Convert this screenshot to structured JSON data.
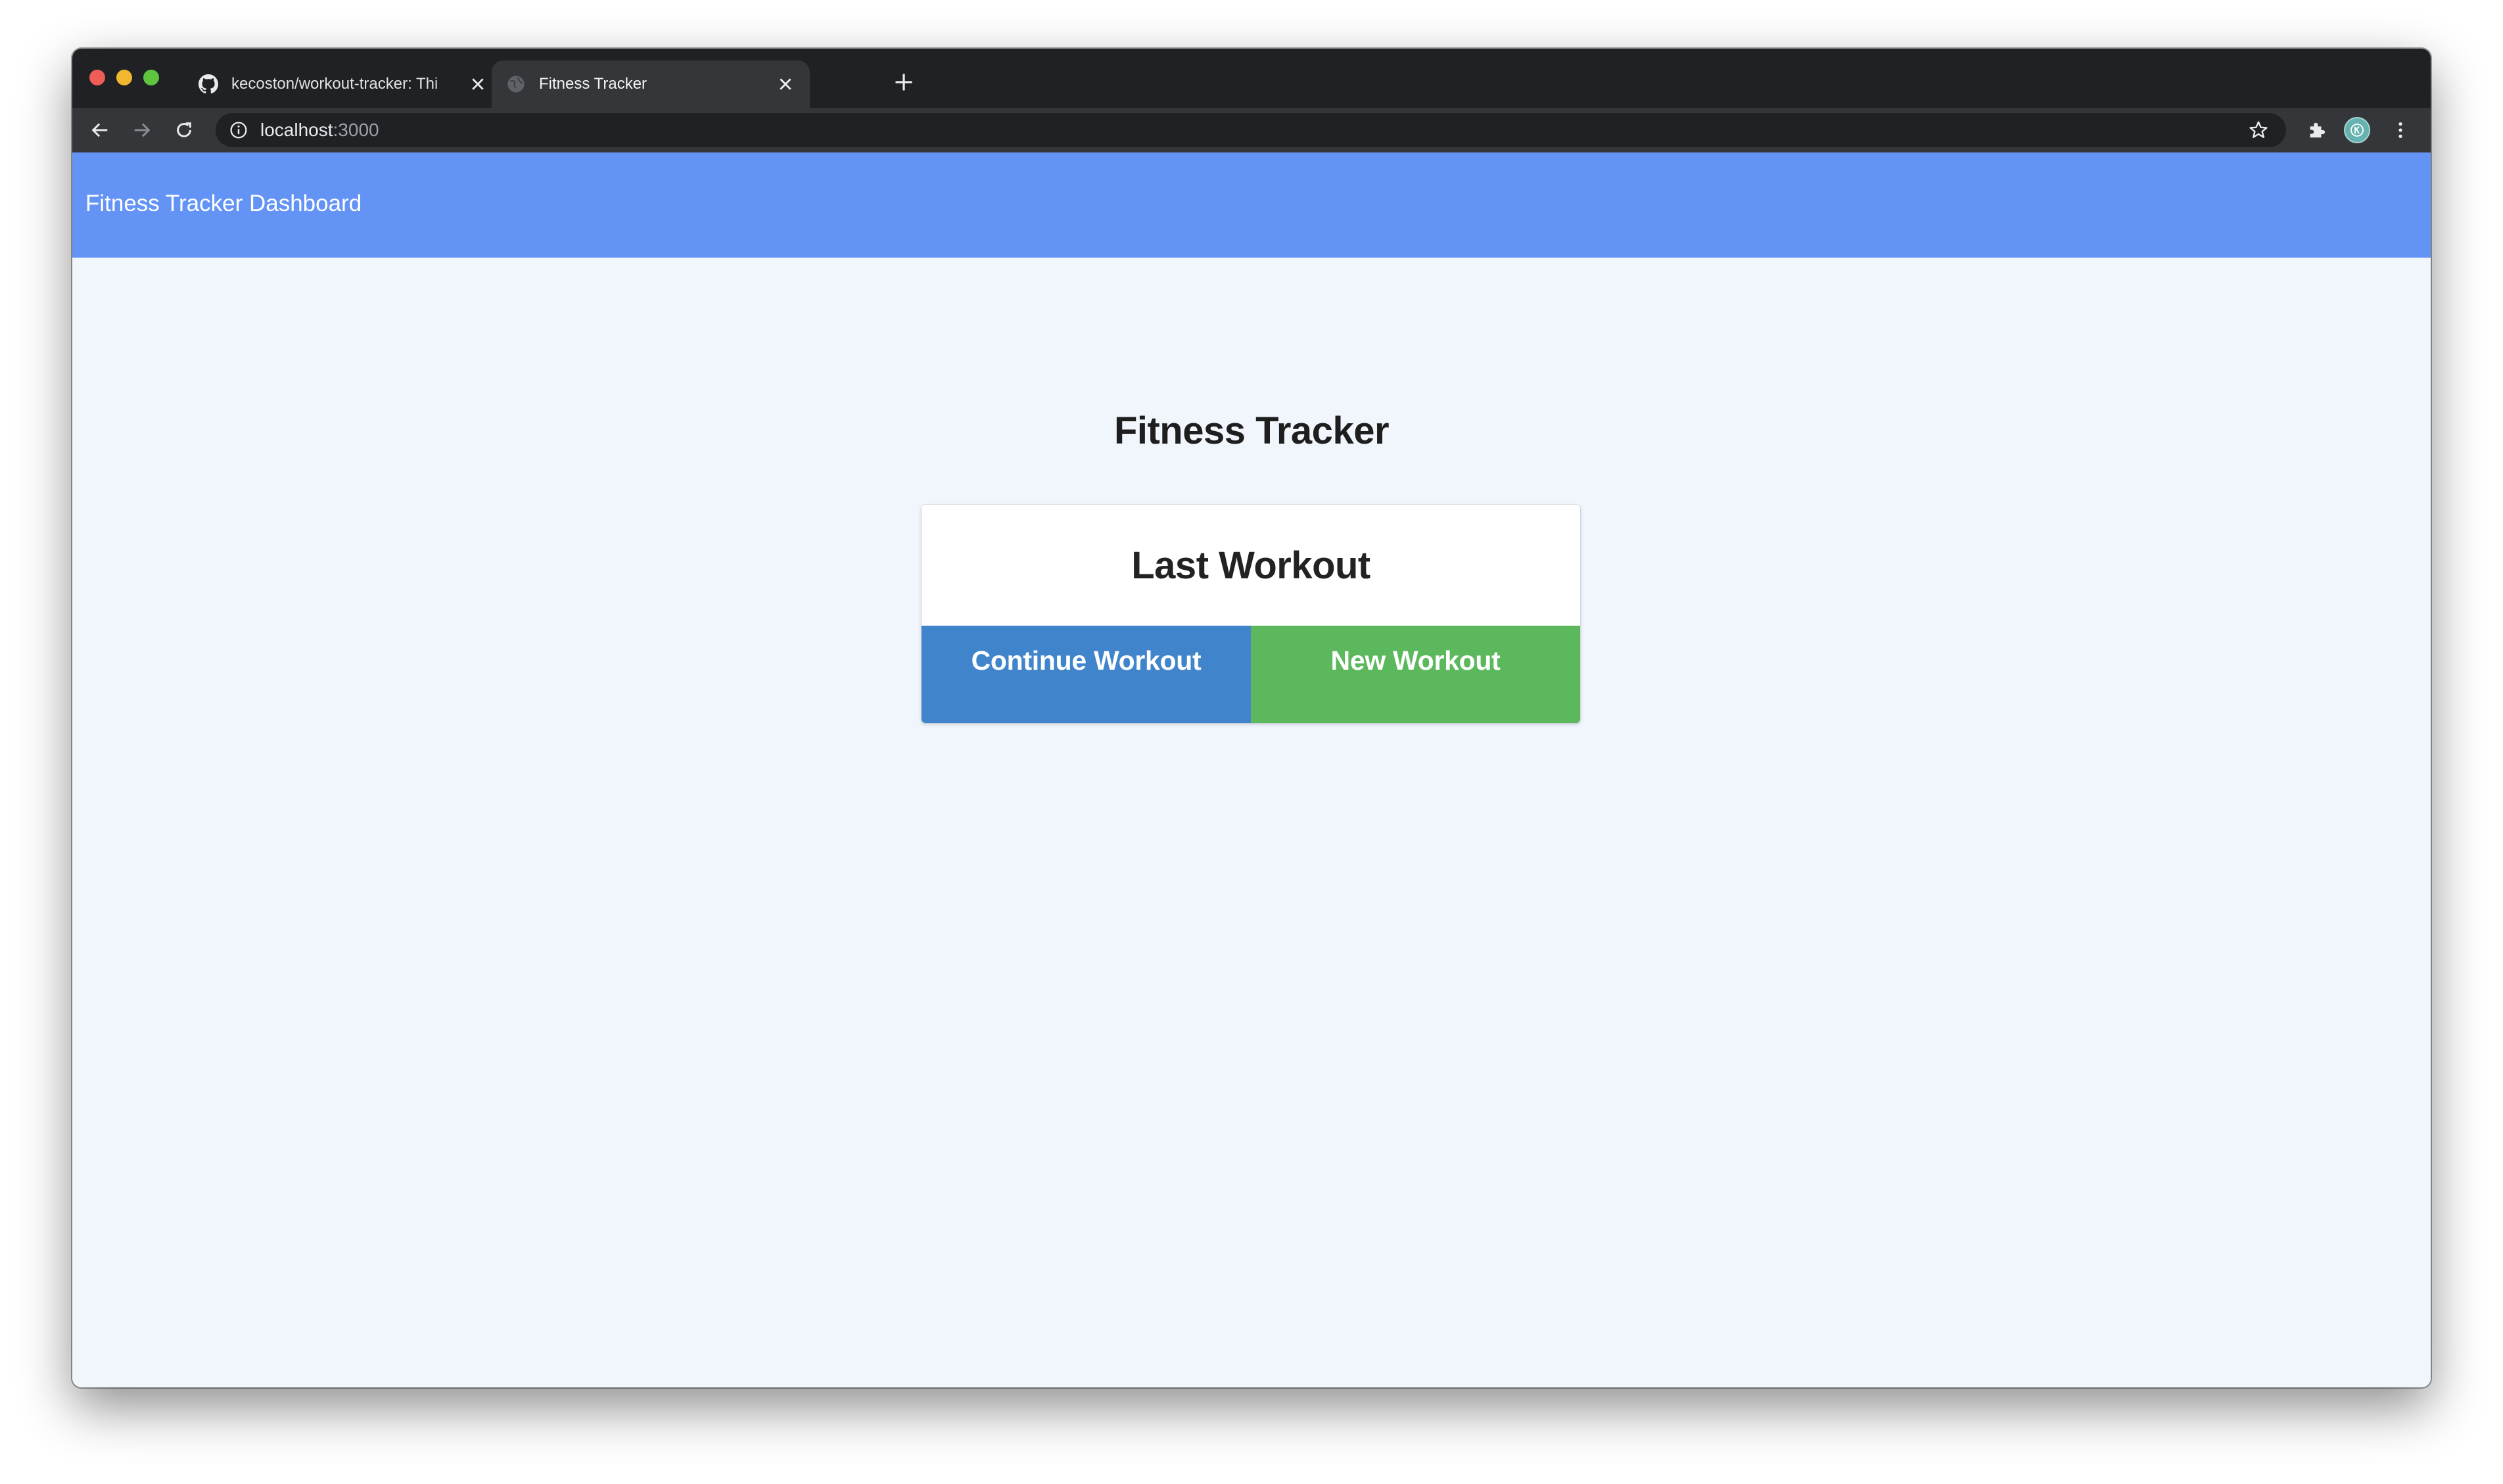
{
  "browser": {
    "tabs": [
      {
        "title": "kecoston/workout-tracker: Thi",
        "active": false,
        "favicon": "github-icon"
      },
      {
        "title": "Fitness Tracker",
        "active": true,
        "favicon": "globe-icon"
      }
    ],
    "address": {
      "host": "localhost",
      "port": ":3000"
    }
  },
  "navbar": {
    "brand": "Fitness Tracker Dashboard",
    "color": "#6394f5"
  },
  "main": {
    "title": "Fitness Tracker",
    "card": {
      "title": "Last Workout",
      "continue_label": "Continue Workout",
      "new_label": "New Workout"
    }
  },
  "colors": {
    "continue_button": "#4085cb",
    "new_button": "#5cb85c",
    "page_background": "#f1f6fd"
  }
}
